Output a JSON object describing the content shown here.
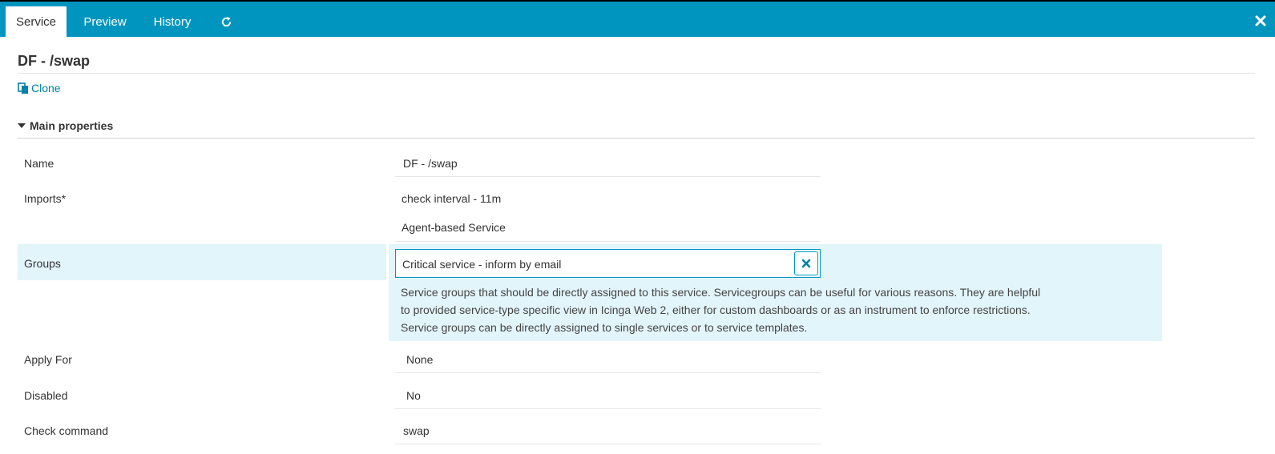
{
  "tabs": [
    {
      "label": "Service",
      "active": true
    },
    {
      "label": "Preview",
      "active": false
    },
    {
      "label": "History",
      "active": false
    }
  ],
  "icons": {
    "refresh": "refresh-icon",
    "close": "close-icon",
    "clone": "copy-icon",
    "collapse": "caret-down-icon",
    "remove": "remove-icon"
  },
  "colors": {
    "accent": "#0095bf",
    "highlight": "#e2f5fb",
    "link": "#0081a8"
  },
  "page": {
    "title": "DF - /swap",
    "clone_label": "Clone"
  },
  "main_properties": {
    "section_title": "Main properties",
    "fields": {
      "name": {
        "label": "Name",
        "value": "DF - /swap"
      },
      "imports": {
        "label": "Imports*",
        "values": [
          "check interval - 11m",
          "Agent-based Service"
        ]
      },
      "groups": {
        "label": "Groups",
        "value": "Critical service - inform by email",
        "description": "Service groups that should be directly assigned to this service. Servicegroups can be useful for various reasons. They are helpful to provided service-type specific view in Icinga Web 2, either for custom dashboards or as an instrument to enforce restrictions. Service groups can be directly assigned to single services or to service templates."
      },
      "apply_for": {
        "label": "Apply For",
        "value": "None"
      },
      "disabled": {
        "label": "Disabled",
        "value": "No"
      },
      "check_command": {
        "label": "Check command",
        "value": "swap"
      }
    }
  }
}
